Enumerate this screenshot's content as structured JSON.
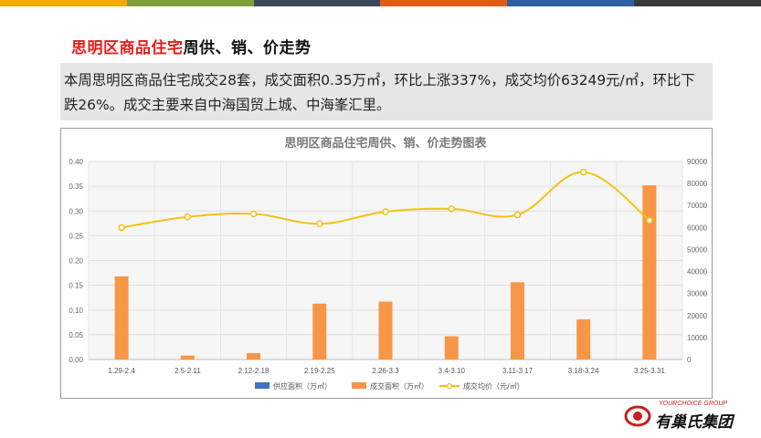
{
  "top_bar_colors": [
    "#f5a800",
    "#7f9f3a",
    "#3b4a5a",
    "#e05c16",
    "#2f5fa0",
    "#3a3a3a"
  ],
  "heading": {
    "red_part": "思明区商品住宅",
    "black_part": "周供、销、价走势"
  },
  "summary": "本周思明区商品住宅成交28套，成交面积0.35万㎡，环比上涨337%，成交均价63249元/㎡，环比下跌26%。成交主要来自中海国贸上城、中海峯汇里。",
  "chart_data": {
    "type": "bar",
    "title": "思明区商品住宅周供、销、价走势图表",
    "categories": [
      "1.29-2.4",
      "2.5-2.11",
      "2.12-2.18",
      "2.19-2.25",
      "2.26-3.3",
      "3.4-3.10",
      "3.11-3.17",
      "3.18-3.24",
      "3.25-3.31"
    ],
    "series": [
      {
        "name": "供应面积（万㎡）",
        "type": "bar",
        "axis": "left",
        "color": "#4472c4",
        "values": [
          0,
          0,
          0,
          0,
          0,
          0,
          0,
          0,
          0
        ]
      },
      {
        "name": "成交面积（万㎡）",
        "type": "bar",
        "axis": "left",
        "color": "#f79646",
        "values": [
          0.168,
          0.008,
          0.013,
          0.113,
          0.117,
          0.047,
          0.156,
          0.081,
          0.352
        ]
      },
      {
        "name": "成交均价（元/㎡）",
        "type": "line",
        "axis": "right",
        "color": "#f2c314",
        "values": [
          60000,
          64800,
          66200,
          61700,
          67200,
          68500,
          65800,
          85200,
          63249
        ]
      }
    ],
    "y_left": {
      "min": 0,
      "max": 0.4,
      "ticks": [
        "0.00",
        "0.05",
        "0.10",
        "0.15",
        "0.20",
        "0.25",
        "0.30",
        "0.35",
        "0.40"
      ]
    },
    "y_right": {
      "min": 0,
      "max": 90000,
      "ticks": [
        "0",
        "10000",
        "20000",
        "30000",
        "40000",
        "50000",
        "60000",
        "70000",
        "80000",
        "90000"
      ]
    },
    "grid": true,
    "legend_position": "bottom"
  },
  "logo": {
    "sub": "YOURCHOICE GROUP",
    "name": "有巢氏集团"
  }
}
